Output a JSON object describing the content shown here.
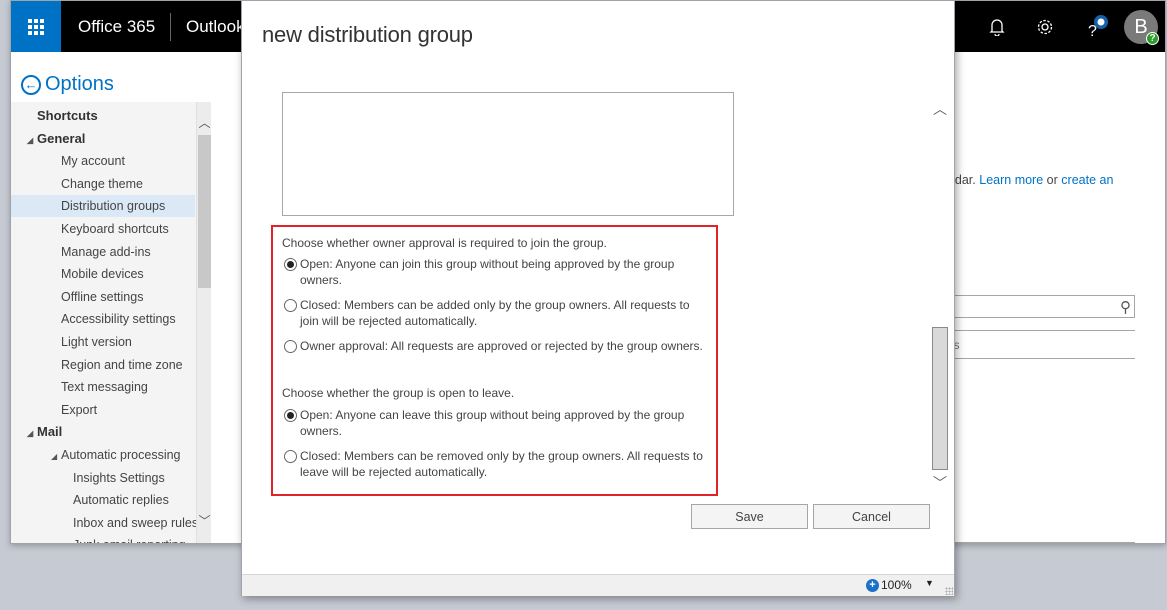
{
  "topbar": {
    "brand": "Office 365",
    "app_name": "Outlook",
    "icons": [
      "app-launcher-icon",
      "bell-icon",
      "gear-icon",
      "help-icon",
      "avatar"
    ],
    "avatar_initial": "B",
    "avatar_badge": "?",
    "accent_color": "#0072c6"
  },
  "options": {
    "title": "Options",
    "nav": [
      {
        "label": "Shortcuts",
        "level": 0,
        "bold": true
      },
      {
        "label": "General",
        "level": 0,
        "bold": true,
        "expanded": true
      },
      {
        "label": "My account",
        "level": 1
      },
      {
        "label": "Change theme",
        "level": 1
      },
      {
        "label": "Distribution groups",
        "level": 1,
        "selected": true
      },
      {
        "label": "Keyboard shortcuts",
        "level": 1
      },
      {
        "label": "Manage add-ins",
        "level": 1
      },
      {
        "label": "Mobile devices",
        "level": 1
      },
      {
        "label": "Offline settings",
        "level": 1
      },
      {
        "label": "Accessibility settings",
        "level": 1
      },
      {
        "label": "Light version",
        "level": 1
      },
      {
        "label": "Region and time zone",
        "level": 1
      },
      {
        "label": "Text messaging",
        "level": 1
      },
      {
        "label": "Export",
        "level": 1
      },
      {
        "label": "Mail",
        "level": 0,
        "bold": true,
        "expanded": true
      },
      {
        "label": "Automatic processing",
        "level": 1,
        "expanded": true
      },
      {
        "label": "Insights Settings",
        "level": 2
      },
      {
        "label": "Automatic replies",
        "level": 2
      },
      {
        "label": "Inbox and sweep rules",
        "level": 2
      },
      {
        "label": "Junk email reporting",
        "level": 2
      }
    ]
  },
  "background_page": {
    "text_fragment": "endar.",
    "learn_more": "Learn more",
    "or_text": "or",
    "create_link": "create an",
    "address_fragment": "ess"
  },
  "dialog": {
    "title": "new distribution group",
    "join_label": "Choose whether owner approval is required to join the group.",
    "join_options": [
      {
        "text": "Open: Anyone can join this group without being approved by the group owners.",
        "selected": true
      },
      {
        "text": "Closed: Members can be added only by the group owners. All requests to join will be rejected automatically.",
        "selected": false
      },
      {
        "text": "Owner approval: All requests are approved or rejected by the group owners.",
        "selected": false
      }
    ],
    "leave_label": "Choose whether the group is open to leave.",
    "leave_options": [
      {
        "text": "Open: Anyone can leave this group without being approved by the group owners.",
        "selected": true
      },
      {
        "text": "Closed: Members can be removed only by the group owners. All requests to leave will be rejected automatically.",
        "selected": false
      }
    ],
    "save_label": "Save",
    "cancel_label": "Cancel",
    "highlight_color": "#e0222a"
  },
  "statusbar": {
    "zoom_level": "100%"
  }
}
